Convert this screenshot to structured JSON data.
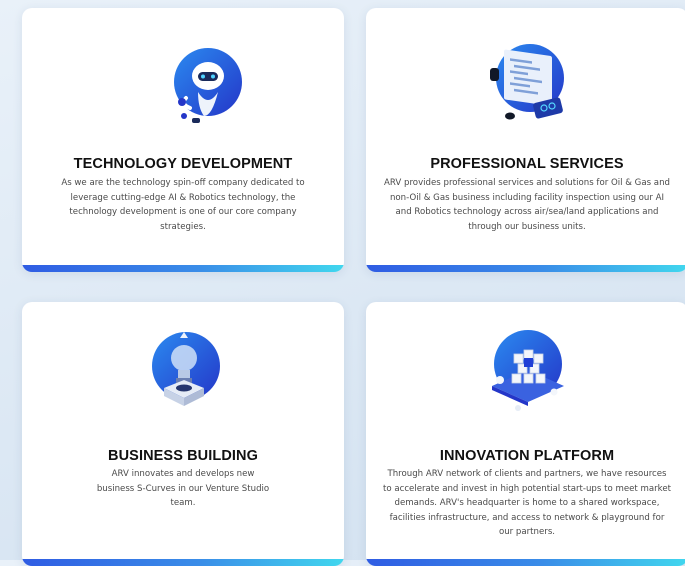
{
  "cards": [
    {
      "title": "TECHNOLOGY DEVELOPMENT",
      "description": "As we are the technology spin-off company dedicated to leverage cutting-edge AI & Robotics technology, the technology development is one of our core company strategies.",
      "icon": "robot-icon"
    },
    {
      "title": "PROFESSIONAL SERVICES",
      "description": "ARV provides professional services and solutions for Oil & Gas and non-Oil & Gas business including facility inspection using our AI and Robotics technology across air/sea/land applications and through our business units.",
      "icon": "code-monitor-icon"
    },
    {
      "title": "BUSINESS BUILDING",
      "description": "ARV innovates and develops new business S-Curves in our Venture Studio team.",
      "icon": "lightbulb-icon"
    },
    {
      "title": "INNOVATION PLATFORM",
      "description": "Through ARV network of clients and partners, we have resources to accelerate and invest in high potential start-ups to meet market demands. ARV's headquarter is home to a shared workspace, facilities infrastructure, and access to network & playground for our partners.",
      "icon": "cubes-platform-icon"
    }
  ],
  "colors": {
    "accent_blue": "#2f5ce3",
    "accent_cyan": "#41d7ee"
  }
}
